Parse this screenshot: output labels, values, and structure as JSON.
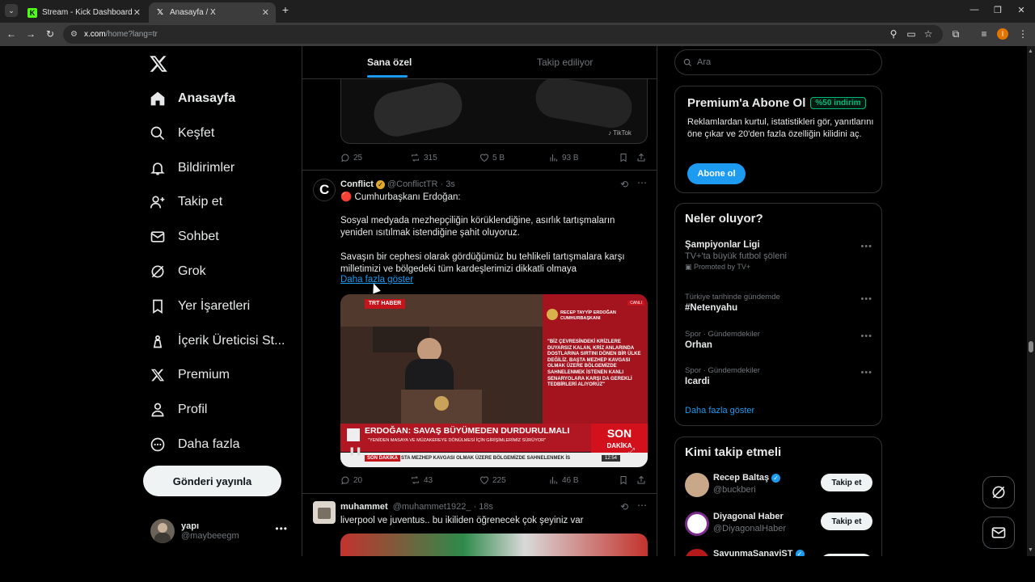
{
  "browser": {
    "tabs": [
      {
        "title": "Stream - Kick Dashboard",
        "active": false
      },
      {
        "title": "Anasayfa / X",
        "active": true
      }
    ],
    "url_host": "x.com",
    "url_path": "/home?lang=tr",
    "profile_initial": "I"
  },
  "nav": {
    "items": [
      {
        "label": "Anasayfa",
        "icon": "home-icon"
      },
      {
        "label": "Keşfet",
        "icon": "search-icon"
      },
      {
        "label": "Bildirimler",
        "icon": "bell-icon"
      },
      {
        "label": "Takip et",
        "icon": "add-user-icon"
      },
      {
        "label": "Sohbet",
        "icon": "mail-icon"
      },
      {
        "label": "Grok",
        "icon": "grok-icon"
      },
      {
        "label": "Yer İşaretleri",
        "icon": "bookmark-icon"
      },
      {
        "label": "İçerik Üreticisi St...",
        "icon": "creator-icon"
      },
      {
        "label": "Premium",
        "icon": "x-icon"
      },
      {
        "label": "Profil",
        "icon": "profile-icon"
      },
      {
        "label": "Daha fazla",
        "icon": "more-icon"
      }
    ],
    "post_button": "Gönderi yayınla",
    "account": {
      "name": "yapı",
      "handle": "@maybeeegm"
    }
  },
  "timeline": {
    "tabs": [
      "Sana özel",
      "Takip ediliyor"
    ],
    "prev_post_actions": {
      "replies": "25",
      "reposts": "315",
      "likes": "5 B",
      "views": "93 B"
    },
    "post1": {
      "name": "Conflict",
      "handle": "@ConflictTR",
      "time": "· 3s",
      "line1": "🔴 Cumhurbaşkanı Erdoğan:",
      "para1": "Sosyal medyada mezhepçiliğin körüklendiğine, asırlık tartışmaların yeniden ısıtılmak istendiğine şahit oluyoruz.",
      "para2": "Savaşın bir cephesi olarak gördüğümüz bu tehlikeli tartışmalara karşı milletimizi ve bölgedeki tüm kardeşlerimizi dikkatli olmaya",
      "show_more": "Daha fazla göster",
      "video": {
        "channel": "TRT HABER",
        "speaker": "RECEP TAYYİP ERDOĞAN",
        "speaker_title": "CUMHURBAŞKANI",
        "quote": "\"BİZ ÇEVRESİNDEKİ KRİZLERE DUYARSIZ KALAN, KRİZ ANLARINDA DOSTLARINA SIRTINI DÖNEN BİR ÜLKE DEĞİLİZ. BAŞTA MEZHEP KAVGASI OLMAK ÜZERE BÖLGEMİZDE SAHNELENMEK İSTENEN KANLI SENARYOLARA KARŞI DA GEREKLİ TEDBİRLERİ ALIYORUZ\"",
        "headline": "ERDOĞAN: SAVAŞ BÜYÜMEDEN DURDURULMALI",
        "subheadline": "\"YENİDEN MASAYA VE MÜZAKEREYE DÖNÜLMESİ İÇİN GİRİŞİMLERİMİZ SÜRÜYOR\"",
        "son1": "SON",
        "son2": "DAKİKA",
        "ticker_label": "SON DAKİKA",
        "ticker": "STA MEZHEP KAVGASI OLMAK ÜZERE BÖLGEMİZDE SAHNELENMEK İS",
        "time": "12:54",
        "live": "CANLI"
      },
      "actions": {
        "replies": "20",
        "reposts": "43",
        "likes": "225",
        "views": "46 B"
      }
    },
    "post2": {
      "name": "muhammet",
      "handle": "@muhammet1922_",
      "time": "· 18s",
      "text": "liverpool ve juventus.. bu ikiliden öğrenecek çok şeyiniz var"
    }
  },
  "sidebar": {
    "search_placeholder": "Ara",
    "premium": {
      "title": "Premium'a Abone Ol",
      "badge": "%50 indirim",
      "text": "Reklamlardan kurtul, istatistikleri gör, yanıtlarını öne çıkar ve 20'den fazla özelliğin kilidini aç.",
      "button": "Abone ol"
    },
    "trends": {
      "title": "Neler oluyor?",
      "items": [
        {
          "context": "",
          "title": "Şampiyonlar Ligi",
          "desc": "TV+'ta büyük futbol şöleni",
          "promo": "Promoted by TV+"
        },
        {
          "context": "Türkiye tarihinde gündemde",
          "title": "#Netenyahu",
          "desc": "",
          "promo": ""
        },
        {
          "context": "Spor · Gündemdekiler",
          "title": "Orhan",
          "desc": "",
          "promo": ""
        },
        {
          "context": "Spor · Gündemdekiler",
          "title": "Icardi",
          "desc": "",
          "promo": ""
        }
      ],
      "show_more": "Daha fazla göster"
    },
    "who_to_follow": {
      "title": "Kimi takip etmeli",
      "items": [
        {
          "name": "Recep Baltaş",
          "handle": "@buckberi",
          "button": "Takip et"
        },
        {
          "name": "Diyagonal Haber",
          "handle": "@DiyagonalHaber",
          "button": "Takip et"
        },
        {
          "name": "SavunmaSanayiST",
          "handle": "",
          "button": ""
        }
      ]
    }
  },
  "colors": {
    "accent": "#1d9bf0",
    "background": "#000000",
    "border": "#2f3336",
    "muted": "#71767b"
  }
}
